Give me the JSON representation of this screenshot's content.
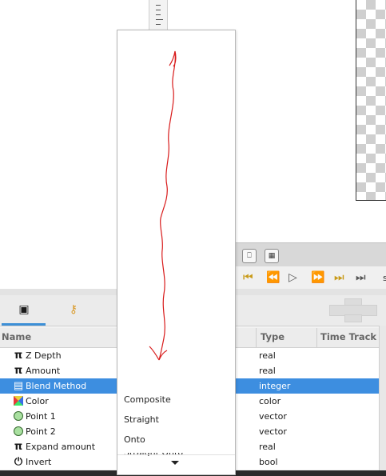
{
  "popup": {
    "options": [
      "Composite",
      "Straight",
      "Onto",
      "Straight Onto"
    ]
  },
  "panel": {
    "columns": {
      "name": "Name",
      "type": "Type",
      "time_track": "Time Track"
    },
    "rows": [
      {
        "icon": "pi-icon",
        "glyph": "π",
        "name": "Z Depth",
        "type": "real",
        "selected": false
      },
      {
        "icon": "pi-icon",
        "glyph": "π",
        "name": "Amount",
        "type": "real",
        "selected": false
      },
      {
        "icon": "blend-method-icon",
        "glyph": "▤",
        "name": "Blend Method",
        "type": "integer",
        "selected": true
      },
      {
        "icon": "color-wheel-icon",
        "glyph": "",
        "name": "Color",
        "type": "color",
        "selected": false
      },
      {
        "icon": "point-icon",
        "glyph": "",
        "name": "Point 1",
        "type": "vector",
        "selected": false
      },
      {
        "icon": "point-icon",
        "glyph": "",
        "name": "Point 2",
        "type": "vector",
        "selected": false
      },
      {
        "icon": "pi-icon",
        "glyph": "π",
        "name": "Expand amount",
        "type": "real",
        "selected": false
      },
      {
        "icon": "power-icon",
        "glyph": "⏻",
        "name": "Invert",
        "type": "bool",
        "selected": false
      }
    ]
  },
  "timebar": {
    "partial_label": "s"
  },
  "colors": {
    "selection": "#3d8ee0",
    "accent_tab": "#3d8fd6",
    "sketch_stroke": "#d81b1b",
    "keyframe_gold": "#c89a18"
  }
}
